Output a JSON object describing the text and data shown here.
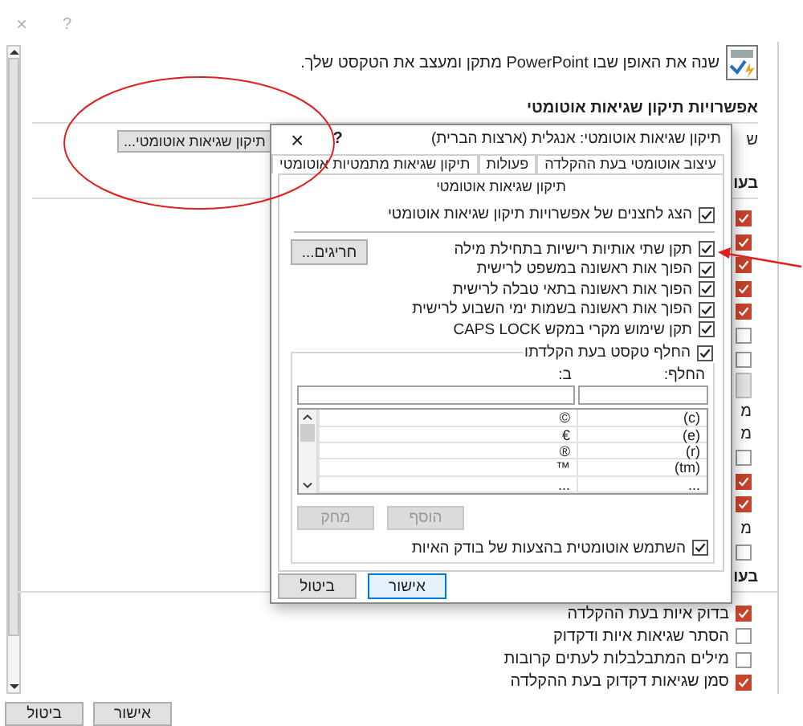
{
  "window": {
    "close": "×",
    "help": "?"
  },
  "intro": "שנה את האופן שבו PowerPoint מתקן ומעצב את הטקסט שלך.",
  "autocorrect_options": {
    "heading": "אפשרויות תיקון שגיאות אוטומטי",
    "row_label": "ש",
    "button": "תיקון שגיאות אוטומטי..."
  },
  "office_section": {
    "heading": "בעו",
    "items": [
      {
        "kind": "checkbox",
        "checked": true
      },
      {
        "kind": "checkbox",
        "checked": true
      },
      {
        "kind": "checkbox",
        "checked": true
      },
      {
        "kind": "checkbox",
        "checked": true
      },
      {
        "kind": "checkbox",
        "checked": true
      },
      {
        "kind": "checkbox",
        "checked": false
      },
      {
        "kind": "checkbox",
        "checked": false
      },
      {
        "kind": "field"
      },
      {
        "kind": "label",
        "label": "מ"
      },
      {
        "kind": "label",
        "label": "מ"
      },
      {
        "kind": "checkbox",
        "checked": false
      },
      {
        "kind": "checkbox",
        "checked": true
      },
      {
        "kind": "checkbox",
        "checked": true
      },
      {
        "kind": "label",
        "label": "מ"
      },
      {
        "kind": "checkbox",
        "checked": false
      }
    ]
  },
  "powerpoint_section": {
    "heading": "בעו",
    "items": [
      {
        "label": "בדוק איות בעת ההקלדה",
        "checked": true
      },
      {
        "label": "הסתר שגיאות איות ודקדוק",
        "checked": false
      },
      {
        "label": "מילים המתבלבלות לעתים קרובות",
        "checked": false
      },
      {
        "label": "סמן שגיאות דקדוק בעת ההקלדה",
        "checked": true
      }
    ]
  },
  "buttons": [
    {
      "label": "אישור"
    },
    {
      "label": "ביטול"
    }
  ],
  "dialog": {
    "title": "תיקון שגיאות אוטומטי: אנגלית (ארצות הברית)",
    "help": "?",
    "close": "×",
    "tabs": [
      {
        "label": "עיצוב אוטומטי בעת ההקלדה",
        "selected": false
      },
      {
        "label": "פעולות",
        "selected": false
      },
      {
        "label": "תיקון שגיאות מתמטיות אוטומטי",
        "selected": false
      },
      {
        "label": "תיקון שגיאות אוטומטי",
        "selected": true
      }
    ],
    "show_buttons": {
      "label": "הצג לחצנים של אפשרויות תיקון שגיאות אוטומטי",
      "checked": true
    },
    "options": [
      {
        "label": "תקן שתי אותיות רישיות בתחילת מילה",
        "checked": true
      },
      {
        "label": "הפוך אות ראשונה במשפט לרישית",
        "checked": true
      },
      {
        "label": "הפוך אות ראשונה בתאי טבלה לרישית",
        "checked": true
      },
      {
        "label": "הפוך אות ראשונה בשמות ימי השבוע לרישית",
        "checked": true
      },
      {
        "label": "תקן שימוש מקרי במקש CAPS LOCK",
        "checked": true
      }
    ],
    "exceptions_button": "חריגים...",
    "replace_group": {
      "label": "החלף טקסט בעת הקלדתו",
      "checked": true,
      "replace_label": "החלף:",
      "with_label": "ב:",
      "rows": [
        {
          "replace": "(c)",
          "with": "©"
        },
        {
          "replace": "(e)",
          "with": "€"
        },
        {
          "replace": "(r)",
          "with": "®"
        },
        {
          "replace": "(tm)",
          "with": "™"
        },
        {
          "replace": "...",
          "with": "..."
        }
      ],
      "add_button": {
        "label": "הוסף",
        "disabled": true
      },
      "delete_button": {
        "label": "מחק",
        "disabled": true
      }
    },
    "use_spellcheck": {
      "label": "השתמש אוטומטית בהצעות של בודק האיות",
      "checked": true
    },
    "buttons": [
      {
        "label": "אישור",
        "default": true
      },
      {
        "label": "ביטול",
        "default": false
      }
    ]
  },
  "annotations": {
    "ellipse": true,
    "arrow": true
  }
}
